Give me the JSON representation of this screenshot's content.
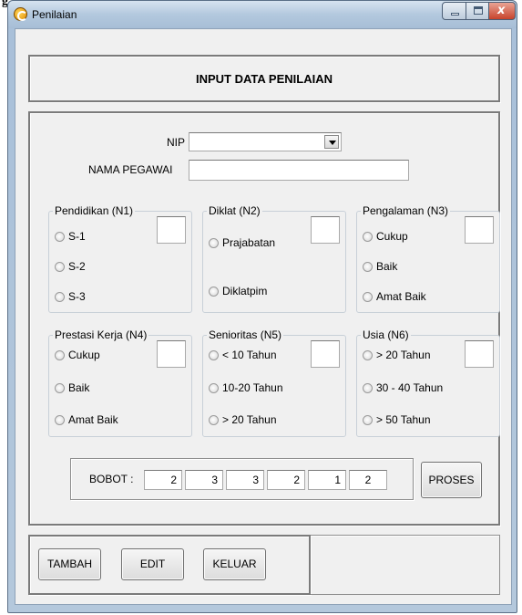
{
  "cropped_label": "g",
  "window": {
    "title": "Penilaian",
    "minimize_glyph": "",
    "maximize_glyph": "",
    "close_glyph": "x"
  },
  "header": {
    "title": "INPUT DATA PENILAIAN"
  },
  "form": {
    "nip_label": "NIP",
    "nip_value": "",
    "nama_label": "NAMA PEGAWAI",
    "nama_value": ""
  },
  "panels": [
    {
      "title": "Pendidikan (N1)",
      "options": [
        "S-1",
        "S-2",
        "S-3"
      ]
    },
    {
      "title": "Diklat (N2)",
      "options": [
        "Prajabatan",
        "Diklatpim"
      ]
    },
    {
      "title": "Pengalaman (N3)",
      "options": [
        "Cukup",
        "Baik",
        "Amat Baik"
      ]
    },
    {
      "title": "Prestasi Kerja (N4)",
      "options": [
        "Cukup",
        "Baik",
        "Amat Baik"
      ]
    },
    {
      "title": "Senioritas (N5)",
      "options": [
        "< 10 Tahun",
        "10-20 Tahun",
        "> 20 Tahun"
      ]
    },
    {
      "title": "Usia (N6)",
      "options": [
        "> 20 Tahun",
        "30 - 40 Tahun",
        "> 50 Tahun"
      ]
    }
  ],
  "bobot": {
    "label": "BOBOT :",
    "values": [
      "2",
      "3",
      "3",
      "2",
      "1",
      "2"
    ]
  },
  "buttons": {
    "proses": "PROSES",
    "tambah": "TAMBAH",
    "edit": "EDIT",
    "keluar": "KELUAR"
  },
  "icons": {
    "app": "app-icon",
    "combo": "chevron-down-icon",
    "radio": "radio-icon"
  }
}
